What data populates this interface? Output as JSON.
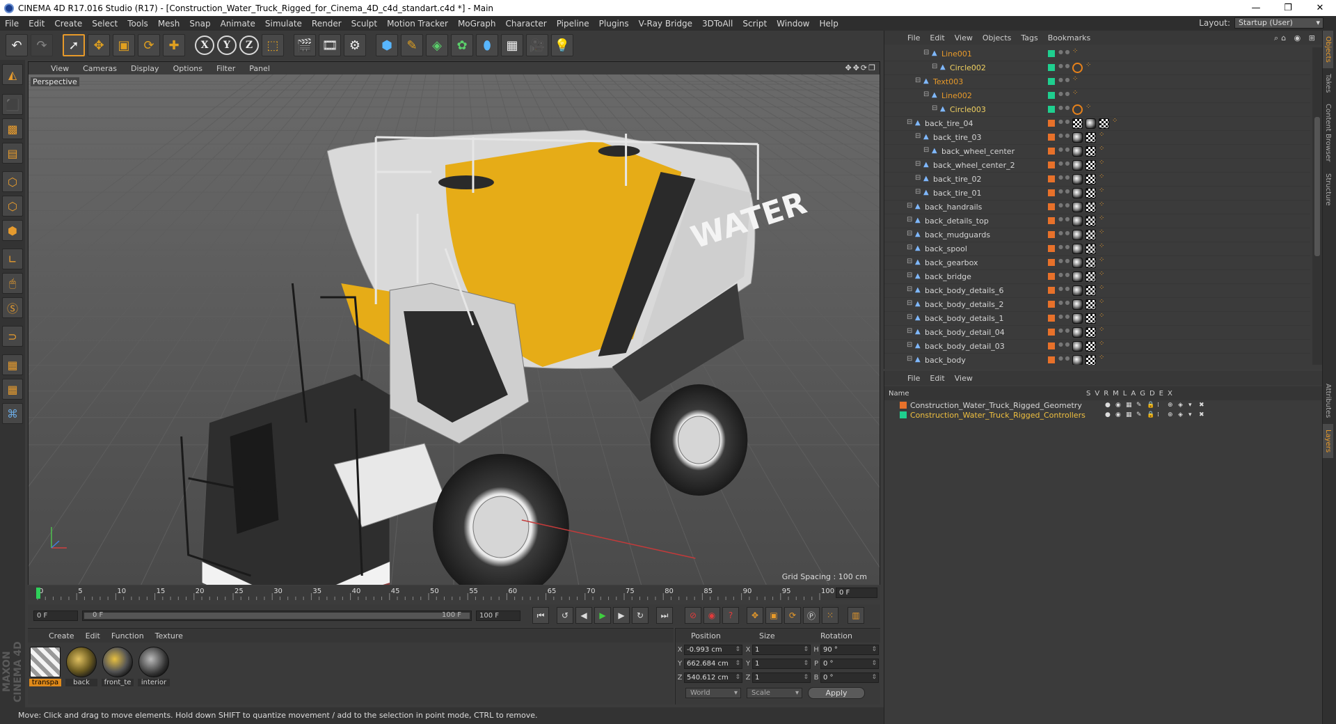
{
  "window": {
    "title": "CINEMA 4D R17.016 Studio (R17) - [Construction_Water_Truck_Rigged_for_Cinema_4D_c4d_standart.c4d *] - Main"
  },
  "menu": [
    "File",
    "Edit",
    "Create",
    "Select",
    "Tools",
    "Mesh",
    "Snap",
    "Animate",
    "Simulate",
    "Render",
    "Sculpt",
    "Motion Tracker",
    "MoGraph",
    "Character",
    "Pipeline",
    "Plugins",
    "V-Ray Bridge",
    "3DToAll",
    "Script",
    "Window",
    "Help"
  ],
  "layout": {
    "label": "Layout:",
    "value": "Startup (User)"
  },
  "viewport": {
    "menu": [
      "View",
      "Cameras",
      "Display",
      "Options",
      "Filter",
      "Panel"
    ],
    "camera": "Perspective",
    "grid_spacing": "Grid Spacing : 100 cm",
    "truck_text": "WATER"
  },
  "timeline": {
    "ticks": [
      "0",
      "5",
      "10",
      "15",
      "20",
      "25",
      "30",
      "35",
      "40",
      "45",
      "50",
      "55",
      "60",
      "65",
      "70",
      "75",
      "80",
      "85",
      "90",
      "95",
      "100"
    ],
    "current": "0 F"
  },
  "transport": {
    "start": "0 F",
    "range_start": "0 F",
    "range_end": "100 F",
    "end": "100 F"
  },
  "materials": {
    "menu": [
      "Create",
      "Edit",
      "Function",
      "Texture"
    ],
    "items": [
      {
        "label": "transpa",
        "selected": true
      },
      {
        "label": "back",
        "selected": false
      },
      {
        "label": "front_te",
        "selected": false
      },
      {
        "label": "interior",
        "selected": false
      }
    ]
  },
  "coords": {
    "headers": [
      "Position",
      "Size",
      "Rotation"
    ],
    "rows": [
      {
        "axis": "X",
        "pos": "-0.993 cm",
        "size_axis": "X",
        "size": "1",
        "rot_axis": "H",
        "rot": "90 °"
      },
      {
        "axis": "Y",
        "pos": "662.684 cm",
        "size_axis": "Y",
        "size": "1",
        "rot_axis": "P",
        "rot": "0 °"
      },
      {
        "axis": "Z",
        "pos": "540.612 cm",
        "size_axis": "Z",
        "size": "1",
        "rot_axis": "B",
        "rot": "0 °"
      }
    ],
    "mode": "World",
    "scale": "Scale",
    "apply": "Apply"
  },
  "status": "Move: Click and drag to move elements. Hold down SHIFT to quantize movement / add to the selection in point mode, CTRL to remove.",
  "objects": {
    "menu": [
      "File",
      "Edit",
      "View",
      "Objects",
      "Tags",
      "Bookmarks"
    ],
    "rows": [
      {
        "name": "Line001",
        "indent": 4,
        "color": "orange",
        "tag": "#1fcf8f",
        "icons": "dots"
      },
      {
        "name": "Circle002",
        "indent": 5,
        "color": "yellow",
        "tag": "#1fcf8f",
        "icons": "no"
      },
      {
        "name": "Text003",
        "indent": 3,
        "color": "orange",
        "tag": "#1fcf8f",
        "icons": "dots"
      },
      {
        "name": "Line002",
        "indent": 4,
        "color": "orange",
        "tag": "#1fcf8f",
        "icons": "dots"
      },
      {
        "name": "Circle003",
        "indent": 5,
        "color": "yellow",
        "tag": "#1fcf8f",
        "icons": "no"
      },
      {
        "name": "back_tire_04",
        "indent": 2,
        "color": "white",
        "tag": "#e8712a",
        "icons": "full"
      },
      {
        "name": "back_tire_03",
        "indent": 3,
        "color": "white",
        "tag": "#e8712a",
        "icons": "mat"
      },
      {
        "name": "back_wheel_center",
        "indent": 4,
        "color": "white",
        "tag": "#e8712a",
        "icons": "mat"
      },
      {
        "name": "back_wheel_center_2",
        "indent": 3,
        "color": "white",
        "tag": "#e8712a",
        "icons": "mat"
      },
      {
        "name": "back_tire_02",
        "indent": 3,
        "color": "white",
        "tag": "#e8712a",
        "icons": "mat"
      },
      {
        "name": "back_tire_01",
        "indent": 3,
        "color": "white",
        "tag": "#e8712a",
        "icons": "mat"
      },
      {
        "name": "back_handrails",
        "indent": 2,
        "color": "white",
        "tag": "#e8712a",
        "icons": "mat"
      },
      {
        "name": "back_details_top",
        "indent": 2,
        "color": "white",
        "tag": "#e8712a",
        "icons": "mat"
      },
      {
        "name": "back_mudguards",
        "indent": 2,
        "color": "white",
        "tag": "#e8712a",
        "icons": "mat"
      },
      {
        "name": "back_spool",
        "indent": 2,
        "color": "white",
        "tag": "#e8712a",
        "icons": "mat"
      },
      {
        "name": "back_gearbox",
        "indent": 2,
        "color": "white",
        "tag": "#e8712a",
        "icons": "mat"
      },
      {
        "name": "back_bridge",
        "indent": 2,
        "color": "white",
        "tag": "#e8712a",
        "icons": "mat"
      },
      {
        "name": "back_body_details_6",
        "indent": 2,
        "color": "white",
        "tag": "#e8712a",
        "icons": "mat"
      },
      {
        "name": "back_body_details_2",
        "indent": 2,
        "color": "white",
        "tag": "#e8712a",
        "icons": "mat"
      },
      {
        "name": "back_body_details_1",
        "indent": 2,
        "color": "white",
        "tag": "#e8712a",
        "icons": "mat"
      },
      {
        "name": "back_body_detail_04",
        "indent": 2,
        "color": "white",
        "tag": "#e8712a",
        "icons": "mat"
      },
      {
        "name": "back_body_detail_03",
        "indent": 2,
        "color": "white",
        "tag": "#e8712a",
        "icons": "mat"
      },
      {
        "name": "back_body",
        "indent": 2,
        "color": "white",
        "tag": "#e8712a",
        "icons": "mat"
      }
    ]
  },
  "layers": {
    "menu": [
      "File",
      "Edit",
      "View"
    ],
    "header_name": "Name",
    "columns": [
      "S",
      "V",
      "R",
      "M",
      "L",
      "A",
      "G",
      "D",
      "E",
      "X"
    ],
    "rows": [
      {
        "name": "Construction_Water_Truck_Rigged_Geometry",
        "color": "#e8712a",
        "style": "geo"
      },
      {
        "name": "Construction_Water_Truck_Rigged_Controllers",
        "color": "#1fcf8f",
        "style": "ctrl"
      }
    ]
  },
  "side_tabs": [
    "Objects",
    "Takes",
    "Content Browser",
    "Structure",
    "Attributes",
    "Layers"
  ]
}
